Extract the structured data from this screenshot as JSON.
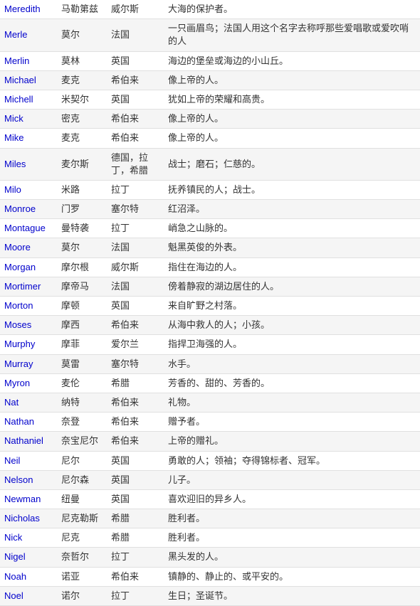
{
  "rows": [
    {
      "name": "Meredith",
      "chinese_name": "马勒第兹",
      "origin": "威尔斯",
      "meaning": "大海的保护者。"
    },
    {
      "name": "Merle",
      "chinese_name": "莫尔",
      "origin": "法国",
      "meaning": "一只画眉鸟；法国人用这个名字去称呼那些爱唱歌或爱吹哨的人"
    },
    {
      "name": "Merlin",
      "chinese_name": "莫林",
      "origin": "英国",
      "meaning": "海边的堡垒或海边的小山丘。"
    },
    {
      "name": "Michael",
      "chinese_name": "麦克",
      "origin": "希伯来",
      "meaning": "像上帝的人。"
    },
    {
      "name": "Michell",
      "chinese_name": "米契尔",
      "origin": "英国",
      "meaning": "犹如上帝的荣耀和高贵。"
    },
    {
      "name": "Mick",
      "chinese_name": "密克",
      "origin": "希伯来",
      "meaning": "像上帝的人。"
    },
    {
      "name": "Mike",
      "chinese_name": "麦克",
      "origin": "希伯来",
      "meaning": "像上帝的人。"
    },
    {
      "name": "Miles",
      "chinese_name": "麦尔斯",
      "origin": "德国，拉丁，希腊",
      "meaning": "战士；磨石；仁慈的。"
    },
    {
      "name": "Milo",
      "chinese_name": "米路",
      "origin": "拉丁",
      "meaning": "抚养镇民的人；战士。"
    },
    {
      "name": "Monroe",
      "chinese_name": "门罗",
      "origin": "塞尔特",
      "meaning": "红沼泽。"
    },
    {
      "name": "Montague",
      "chinese_name": "曼特袭",
      "origin": "拉丁",
      "meaning": "峭急之山脉的。"
    },
    {
      "name": "Moore",
      "chinese_name": "莫尔",
      "origin": "法国",
      "meaning": "魁黑英俊的外表。"
    },
    {
      "name": "Morgan",
      "chinese_name": "摩尔根",
      "origin": "威尔斯",
      "meaning": "指住在海边的人。"
    },
    {
      "name": "Mortimer",
      "chinese_name": "摩帝马",
      "origin": "法国",
      "meaning": "傍着静寂的湖边居住的人。"
    },
    {
      "name": "Morton",
      "chinese_name": "摩顿",
      "origin": "英国",
      "meaning": "来自旷野之村落。"
    },
    {
      "name": "Moses",
      "chinese_name": "摩西",
      "origin": "希伯来",
      "meaning": "从海中救人的人；小孩。"
    },
    {
      "name": "Murphy",
      "chinese_name": "摩菲",
      "origin": "爱尔兰",
      "meaning": "指捍卫海强的人。"
    },
    {
      "name": "Murray",
      "chinese_name": "莫雷",
      "origin": "塞尔特",
      "meaning": "水手。"
    },
    {
      "name": "Myron",
      "chinese_name": "麦伦",
      "origin": "希腊",
      "meaning": "芳香的、甜的、芳香的。"
    },
    {
      "name": "Nat",
      "chinese_name": "纳特",
      "origin": "希伯来",
      "meaning": "礼物。"
    },
    {
      "name": "Nathan",
      "chinese_name": "奈登",
      "origin": "希伯来",
      "meaning": "赠予者。"
    },
    {
      "name": "Nathaniel",
      "chinese_name": "奈宝尼尔",
      "origin": "希伯来",
      "meaning": "上帝的赠礼。"
    },
    {
      "name": "Neil",
      "chinese_name": "尼尔",
      "origin": "英国",
      "meaning": "勇敢的人；领袖；夺得锦标者、冠军。"
    },
    {
      "name": "Nelson",
      "chinese_name": "尼尔森",
      "origin": "英国",
      "meaning": "儿子。"
    },
    {
      "name": "Newman",
      "chinese_name": "纽曼",
      "origin": "英国",
      "meaning": "喜欢迎旧的异乡人。"
    },
    {
      "name": "Nicholas",
      "chinese_name": "尼克勒斯",
      "origin": "希腊",
      "meaning": "胜利者。"
    },
    {
      "name": "Nick",
      "chinese_name": "尼克",
      "origin": "希腊",
      "meaning": "胜利者。"
    },
    {
      "name": "Nigel",
      "chinese_name": "奈哲尔",
      "origin": "拉丁",
      "meaning": "黑头发的人。"
    },
    {
      "name": "Noah",
      "chinese_name": "诺亚",
      "origin": "希伯来",
      "meaning": "镇静的、静止的、或平安的。"
    },
    {
      "name": "Noel",
      "chinese_name": "诺尔",
      "origin": "拉丁",
      "meaning": "生日；圣诞节。"
    }
  ]
}
